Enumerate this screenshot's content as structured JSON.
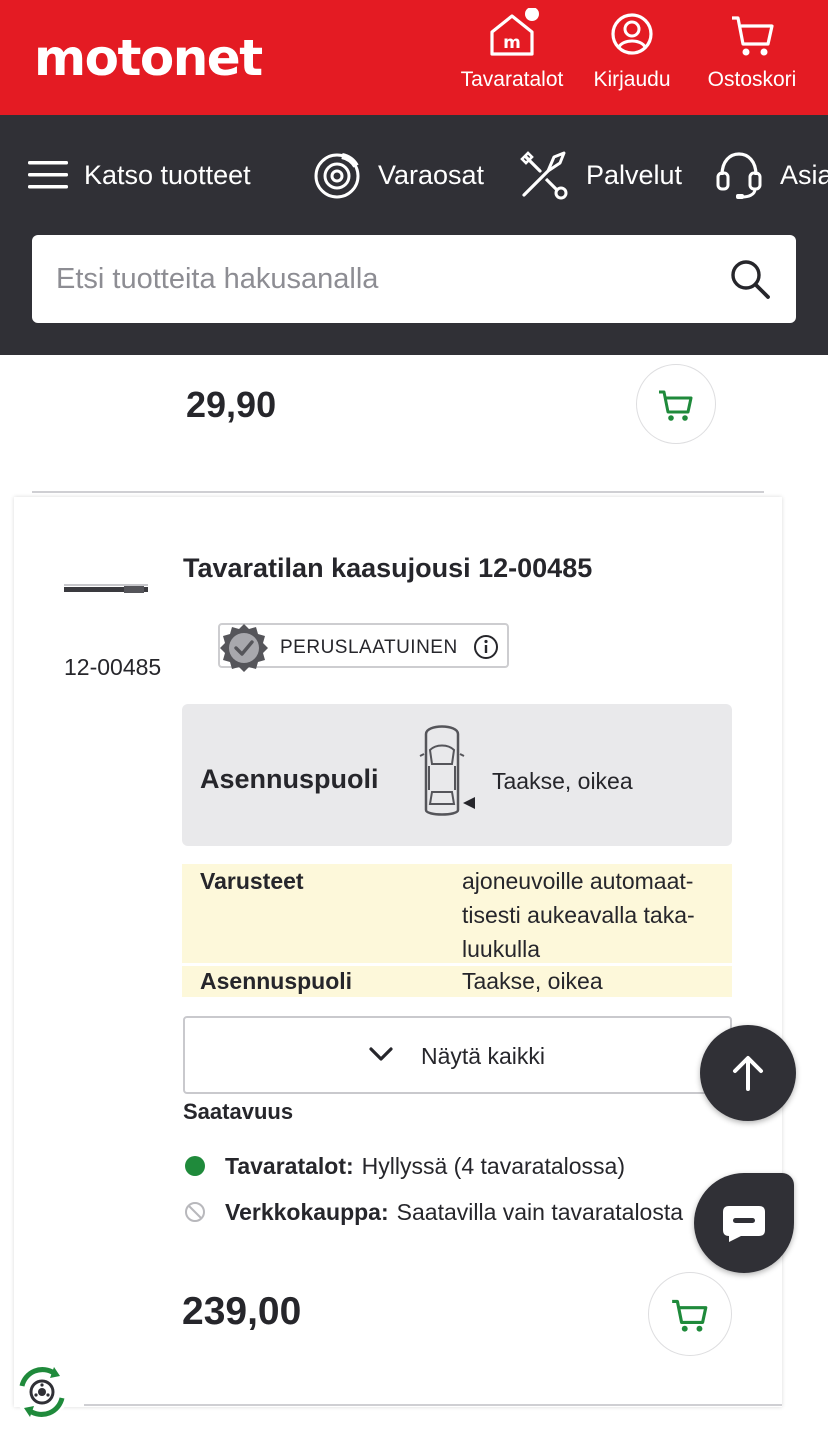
{
  "header": {
    "logo": "motonet",
    "stores_label": "Tavaratalot",
    "login_label": "Kirjaudu",
    "cart_label": "Ostoskori",
    "store_icon_letter": "m"
  },
  "nav": {
    "menu_label": "Katso tuotteet",
    "parts_label": "Varaosat",
    "services_label": "Palvelut",
    "support_label": "Asiakaspalvelu"
  },
  "search": {
    "placeholder": "Etsi tuotteita hakusanalla"
  },
  "previous_product": {
    "price": "29,90"
  },
  "product": {
    "sku": "12-00485",
    "title": "Tavaratilan kaasujousi 12-00485",
    "quality_label": "PERUSLAATUINEN",
    "install_side_label": "Asennuspuoli",
    "install_side_value": "Taakse, oikea",
    "specs": [
      {
        "key": "Varusteet",
        "value": "ajoneuvoille automaat-tisesti aukeavalla taka-luukulla"
      },
      {
        "key": "Asennuspuoli",
        "value": "Taakse, oikea"
      }
    ],
    "show_all_label": "Näytä kaikki",
    "availability_title": "Saatavuus",
    "availability": [
      {
        "key": "Tavaratalot:",
        "value": "Hyllyssä (4 tavaratalossa)",
        "status": "in-stock",
        "color": "#1f8a3b"
      },
      {
        "key": "Verkkokauppa:",
        "value": "Saatavilla vain tavaratalosta",
        "status": "unavailable",
        "color": "#b8b8bc"
      }
    ],
    "price": "239,00"
  },
  "colors": {
    "brand_red": "#e41b23",
    "nav_dark": "#303036",
    "cart_green": "#1f8a3b",
    "spec_highlight": "#fdf8da"
  }
}
